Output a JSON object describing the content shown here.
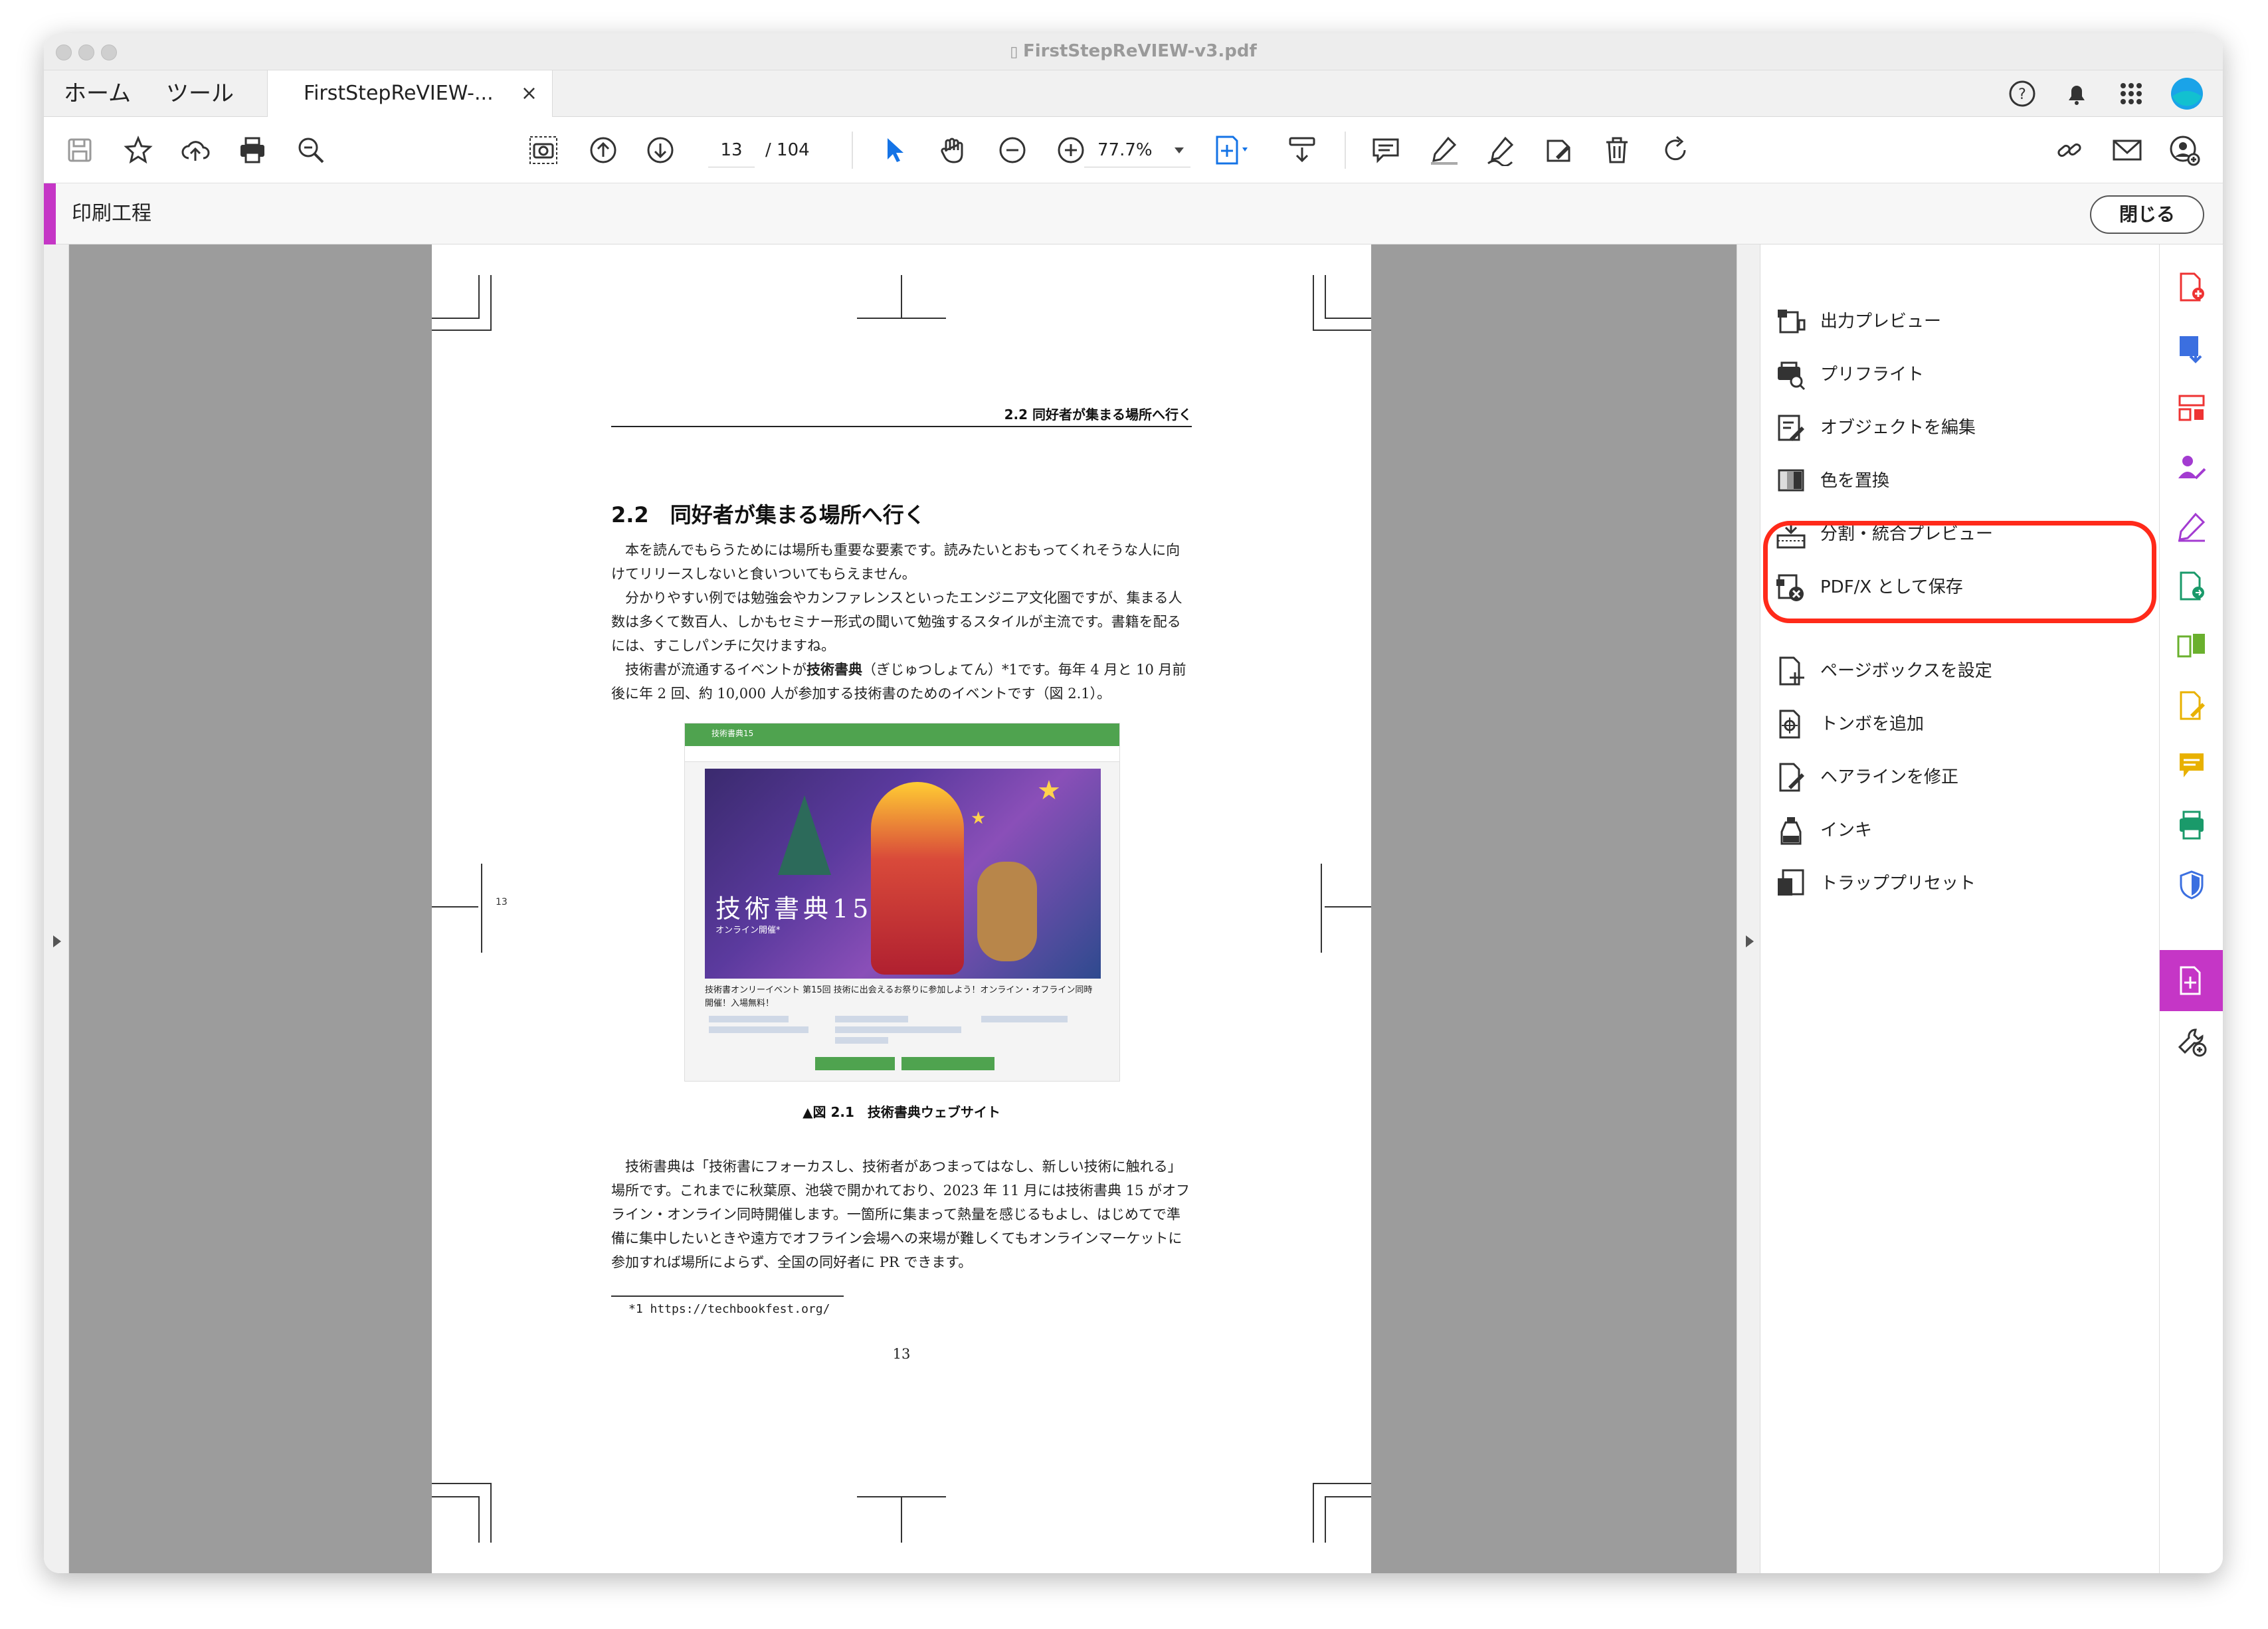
{
  "window": {
    "file_title": "FirstStepReVIEW-v3.pdf"
  },
  "tabs": {
    "home": "ホーム",
    "tools": "ツール",
    "document": "FirstStepReVIEW-...",
    "close": "×"
  },
  "toolbar": {
    "page_current": "13",
    "page_total": "/ 104",
    "zoom": "77.7%"
  },
  "tool_header": {
    "name": "印刷工程",
    "close_label": "閉じる",
    "accent_color": "#c536c6"
  },
  "document": {
    "running_head": "2.2 同好者が集まる場所へ行く",
    "heading": "2.2　同好者が集まる場所へ行く",
    "para1": "本を読んでもらうためには場所も重要な要素です。読みたいとおもってくれそうな人に向けてリリースしないと食いついてもらえません。",
    "para2": "分かりやすい例では勉強会やカンファレンスといったエンジニア文化圏ですが、集まる人数は多くて数百人、しかもセミナー形式の聞いて勉強するスタイルが主流です。書籍を配るには、すこしパンチに欠けますね。",
    "para3_pre": "技術書が流通するイベントが",
    "para3_bold": "技術書典",
    "para3_post": "（ぎじゅつしょてん）*1です。毎年 4 月と 10 月前後に年 2 回、約 10,000 人が参加する技術書のためのイベントです（図 2.1）。",
    "figure_site_title": "技術書典15",
    "figure_banner_title": "技術書典15",
    "figure_banner_sub": "オンライン開催*",
    "figure_text": "技術書オンリーイベント 第15回 技術に出会えるお祭りに参加しよう！オンライン・オフライン同時開催！入場無料！",
    "figure_caption": "▲図 2.1　技術書典ウェブサイト",
    "para4": "技術書典は「技術書にフォーカスし、技術者があつまってはなし、新しい技術に触れる」場所です。これまでに秋葉原、池袋で開かれており、2023 年 11 月には技術書典 15 がオフライン・オンライン同時開催します。一箇所に集まって熱量を感じるもよし、はじめてで準備に集中したいときや遠方でオフライン会場への来場が難しくてもオンラインマーケットに参加すれば場所によらず、全国の同好者に PR できます。",
    "footnote": "*1 https://techbookfest.org/",
    "page_number": "13",
    "side_number": "13"
  },
  "panel": {
    "items": [
      {
        "label": "出力プレビュー",
        "icon": "output-preview-icon"
      },
      {
        "label": "プリフライト",
        "icon": "preflight-icon"
      },
      {
        "label": "オブジェクトを編集",
        "icon": "edit-object-icon"
      },
      {
        "label": "色を置換",
        "icon": "replace-color-icon"
      },
      {
        "label": "分割・統合プレビュー",
        "icon": "flattener-preview-icon"
      },
      {
        "label": "PDF/X として保存",
        "icon": "save-pdfx-icon"
      },
      {
        "label": "ページボックスを設定",
        "icon": "page-box-icon"
      },
      {
        "label": "トンボを追加",
        "icon": "printer-marks-icon"
      },
      {
        "label": "ヘアラインを修正",
        "icon": "fix-hairlines-icon"
      },
      {
        "label": "インキ",
        "icon": "ink-icon"
      },
      {
        "label": "トラッププリセット",
        "icon": "trap-preset-icon"
      }
    ],
    "highlight_color": "#ff2a1a"
  }
}
